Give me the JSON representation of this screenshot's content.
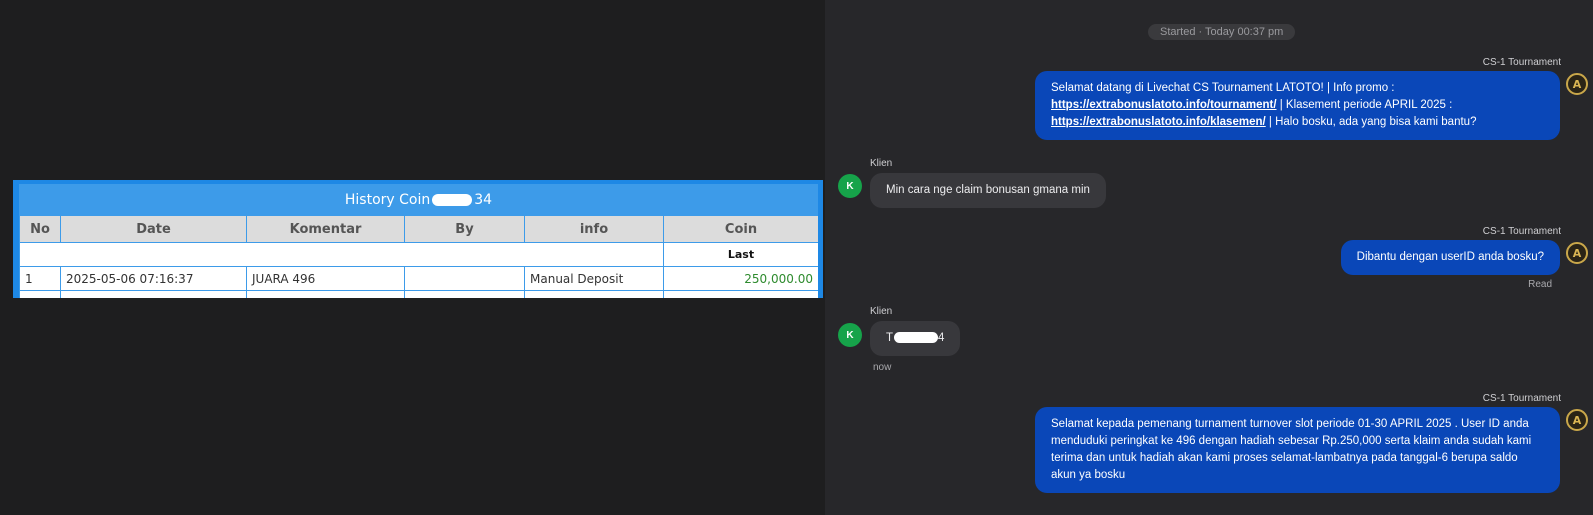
{
  "history": {
    "title_prefix": "History Coin",
    "title_suffix": "34",
    "columns": [
      "No",
      "Date",
      "Komentar",
      "By",
      "info",
      "Coin"
    ],
    "subheader_last": "Last",
    "rows": [
      {
        "no": "1",
        "date": "2025-05-06 07:16:37",
        "komentar": "JUARA 496",
        "by": "",
        "info": "Manual Deposit",
        "coin": "250,000.00"
      }
    ]
  },
  "chat": {
    "session_label": "Started · Today 00:37 pm",
    "messages": [
      {
        "sender": "CS-1 Tournament",
        "line1_pre": "Selamat datang di Livechat CS Tournament LATOTO! | Info promo :",
        "link1": "https://extrabonuslatoto.info/tournament/",
        "mid": " | Klasement periode APRIL 2025 :",
        "link2": "https://extrabonuslatoto.info/klasemen/",
        "tail": " | Halo bosku, ada yang bisa kami bantu?"
      },
      {
        "sender": "Klien",
        "text": "Min cara nge claim bonusan gmana min"
      },
      {
        "sender": "CS-1 Tournament",
        "text": "Dibantu dengan userID anda bosku?",
        "status": "Read"
      },
      {
        "sender": "Klien",
        "text_prefix": "T",
        "text_suffix": "4",
        "time": "now"
      },
      {
        "sender": "CS-1 Tournament",
        "text": "Selamat kepada pemenang turnament turnover slot periode 01-30 APRIL 2025 . User ID anda menduduki peringkat ke 496 dengan hadiah sebesar Rp.250,000 serta klaim anda sudah kami terima dan untuk hadiah akan kami proses selamat-lambatnya pada tanggal-6 berupa saldo akun ya bosku"
      }
    ],
    "client_avatar_letter": "K",
    "agent_avatar_letter": "A"
  },
  "colors": {
    "agent_bubble": "#0a47b8",
    "client_bubble": "#38383c",
    "table_header": "#3d9be9",
    "coin_value": "#2e8b2e"
  }
}
